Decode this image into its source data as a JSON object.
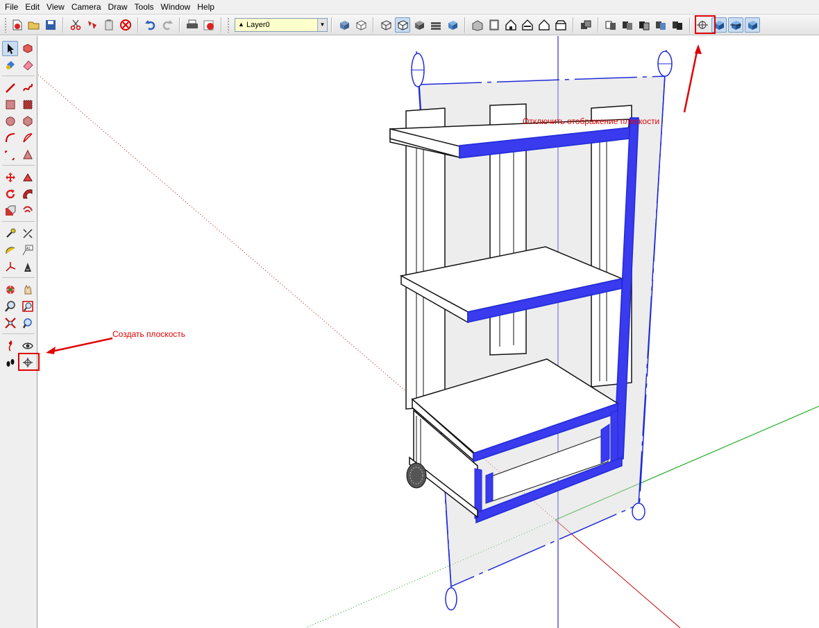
{
  "menu": [
    "File",
    "Edit",
    "View",
    "Camera",
    "Draw",
    "Tools",
    "Window",
    "Help"
  ],
  "layer": {
    "current": "Layer0"
  },
  "annotations": {
    "create_plane": "Создать плоскость",
    "toggle_plane_display": "Отключить отображение плоскости"
  },
  "colors": {
    "highlight": "#e00000",
    "section_blue": "#1f2bd6",
    "axis_red": "#c40000",
    "axis_green": "#00a000",
    "axis_blue": "#0000c8"
  },
  "icons": {
    "toolbar": [
      "new-file-icon",
      "open-icon",
      "save-icon",
      "cut-icon",
      "copy-icon",
      "paste-icon",
      "erase-icon",
      "undo-icon",
      "redo-icon",
      "print-icon",
      "model-info-icon",
      "layer-cursor-icon",
      "xray-icon",
      "back-edges-icon",
      "wireframe-icon",
      "hidden-line-icon",
      "shaded-icon",
      "shaded-textures-icon",
      "monochrome-icon",
      "iso-view-icon",
      "top-view-icon",
      "front-view-icon",
      "right-view-icon",
      "back-view-icon",
      "left-view-icon",
      "components-icon",
      "section-plane-icon",
      "display-section-planes-icon",
      "display-section-cuts-icon"
    ],
    "tools": [
      "select-icon",
      "make-component-icon",
      "paint-bucket-icon",
      "eraser-icon",
      "line-icon",
      "freehand-icon",
      "rectangle-icon",
      "rotated-rectangle-icon",
      "circle-icon",
      "polygon-icon",
      "arc-icon",
      "two-point-arc-icon",
      "pie-icon",
      "push-pull-icon",
      "move-icon",
      "follow-me-icon",
      "rotate-icon",
      "scale-icon",
      "offset-icon",
      "tape-measure-icon",
      "dimension-icon",
      "protractor-icon",
      "text-icon",
      "axes-icon",
      "3d-text-icon",
      "orbit-icon",
      "pan-icon",
      "zoom-icon",
      "zoom-window-icon",
      "zoom-extents-icon",
      "previous-view-icon",
      "position-camera-icon",
      "look-around-icon",
      "walk-icon",
      "section-plane-tool-icon"
    ]
  }
}
